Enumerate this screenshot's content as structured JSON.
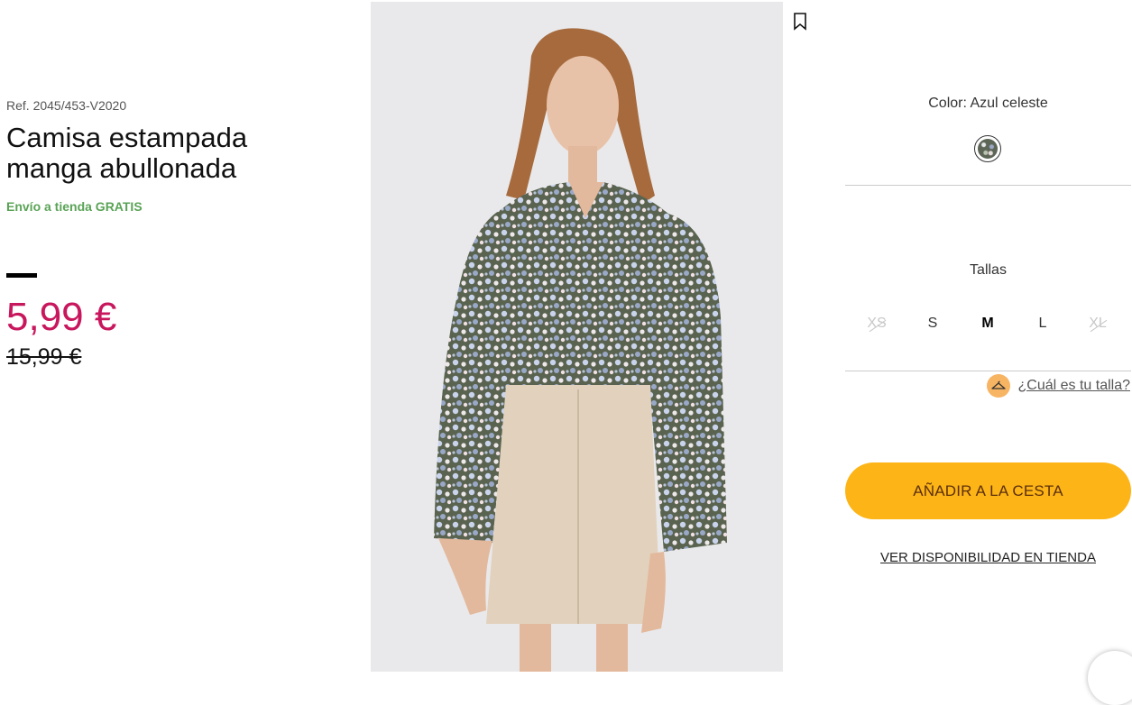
{
  "product": {
    "reference": "Ref. 2045/453-V2020",
    "title": "Camisa estampada manga abullonada",
    "shipping": "Envío a tienda GRATIS",
    "price": "5,99 €",
    "old_price": "15,99 €"
  },
  "options": {
    "color_label": "Color: Azul celeste",
    "sizes_label": "Tallas",
    "sizes": [
      {
        "label": "XS",
        "available": false
      },
      {
        "label": "S",
        "available": true
      },
      {
        "label": "M",
        "available": true,
        "selected": true
      },
      {
        "label": "L",
        "available": true
      },
      {
        "label": "XL",
        "available": false
      }
    ],
    "size_guide": "¿Cuál es tu talla?"
  },
  "actions": {
    "add_to_cart": "AÑADIR A LA CESTA",
    "store_availability": "VER DISPONIBILIDAD EN TIENDA"
  },
  "colors": {
    "price": "#c8175d",
    "shipping": "#5aa356",
    "cta": "#fdb416"
  },
  "icons": {
    "bookmark": "bookmark-icon",
    "hanger": "hanger-icon",
    "chat": "chat-icon"
  }
}
